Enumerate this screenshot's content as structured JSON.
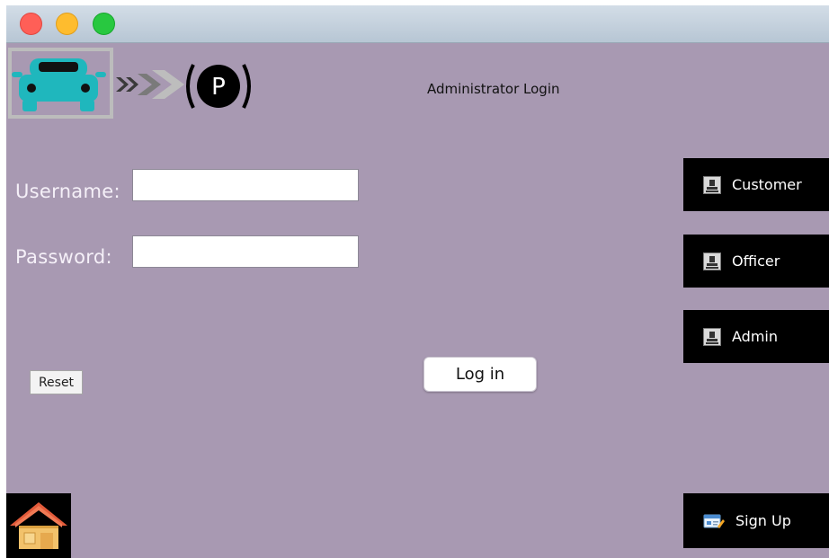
{
  "window": {
    "title": "",
    "traffic_lights": [
      "close",
      "minimize",
      "maximize"
    ],
    "background_color": "#a899b2"
  },
  "logo": {
    "icons": [
      "car-icon",
      "arrow-chevrons-icon",
      "parking-p-icon"
    ],
    "parking_letter": "P"
  },
  "header": {
    "title": "Administrator Login"
  },
  "form": {
    "username_label": "Username:",
    "username_value": "",
    "password_label": "Password:",
    "password_value": ""
  },
  "buttons": {
    "reset": "Reset",
    "login": "Log in"
  },
  "sidebar": {
    "items": [
      {
        "label": "Customer",
        "icon": "person-icon"
      },
      {
        "label": "Officer",
        "icon": "person-icon"
      },
      {
        "label": "Admin",
        "icon": "person-icon"
      }
    ],
    "signup": {
      "label": "Sign Up",
      "icon": "signup-card-icon"
    }
  },
  "home": {
    "icon": "home-icon"
  },
  "colors": {
    "accent_car": "#1fb7bd",
    "button_dark": "#000000"
  }
}
